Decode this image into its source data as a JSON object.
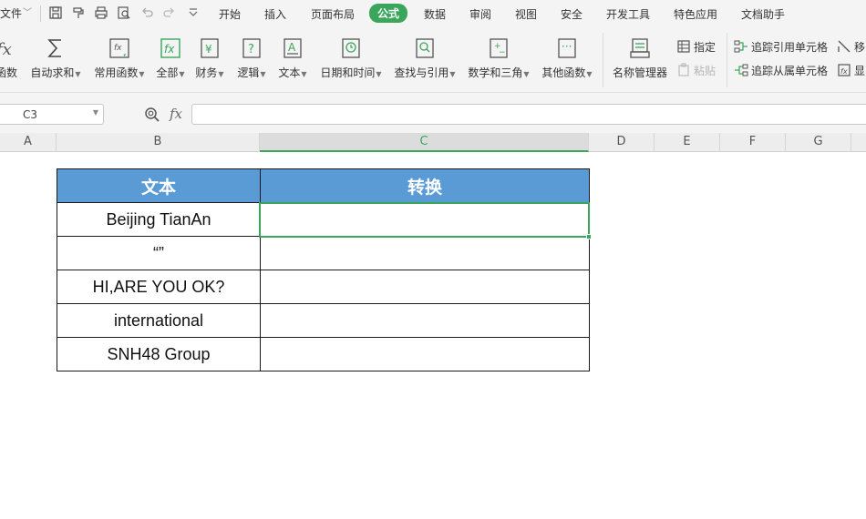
{
  "menubar": {
    "file": "文件",
    "tabs": [
      "开始",
      "插入",
      "页面布局",
      "公式",
      "数据",
      "审阅",
      "视图",
      "安全",
      "开发工具",
      "特色应用",
      "文档助手"
    ],
    "active_tab": "公式"
  },
  "ribbon": {
    "buttons": [
      {
        "label": "函数"
      },
      {
        "label": "自动求和"
      },
      {
        "label": "常用函数"
      },
      {
        "label": "全部"
      },
      {
        "label": "财务"
      },
      {
        "label": "逻辑"
      },
      {
        "label": "文本"
      },
      {
        "label": "日期和时间"
      },
      {
        "label": "查找与引用"
      },
      {
        "label": "数学和三角"
      },
      {
        "label": "其他函数"
      },
      {
        "label": "名称管理器"
      }
    ],
    "small": {
      "assign": "指定",
      "paste": "粘贴",
      "trace_precedents": "追踪引用单元格",
      "trace_dependents": "追踪从属单元格",
      "move": "移",
      "show": "显"
    }
  },
  "formula_bar": {
    "name_box": "C3",
    "fx": "fx",
    "formula": ""
  },
  "columns": [
    "A",
    "B",
    "C",
    "D",
    "E",
    "F",
    "G"
  ],
  "selected_column": "C",
  "sheet": {
    "headers": [
      "文本",
      "转换"
    ],
    "rows": [
      [
        "Beijing TianAn",
        ""
      ],
      [
        "“”",
        ""
      ],
      [
        "HI,ARE YOU OK?",
        ""
      ],
      [
        "international",
        ""
      ],
      [
        "SNH48 Group",
        ""
      ]
    ]
  },
  "colors": {
    "accent": "#3aa65c",
    "header_fill": "#5b9bd5"
  }
}
